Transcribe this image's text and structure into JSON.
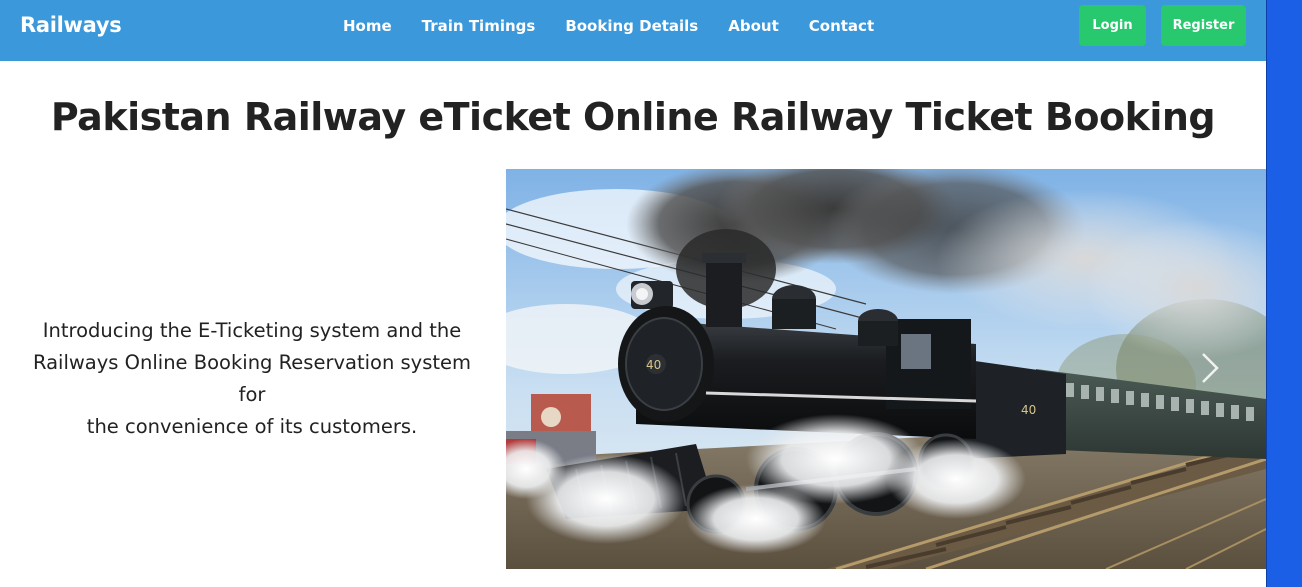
{
  "navbar": {
    "brand": "Railways",
    "links": [
      "Home",
      "Train Timings",
      "Booking Details",
      "About",
      "Contact"
    ],
    "login_label": "Login",
    "register_label": "Register"
  },
  "main": {
    "title": "Pakistan Railway eTicket Online Railway Ticket Booking",
    "intro_line1": "Introducing the E-Ticketing system and the",
    "intro_line2": "Railways Online Booking Reservation system for",
    "intro_line3": "the convenience of its customers.",
    "hero_image": "steam-locomotive-photo",
    "locomotive_number": "40",
    "carousel_next_icon": "chevron-right-icon"
  },
  "colors": {
    "navbar_bg": "#3a98db",
    "button_bg": "#27c86e",
    "right_strip": "#1b5fe6"
  }
}
